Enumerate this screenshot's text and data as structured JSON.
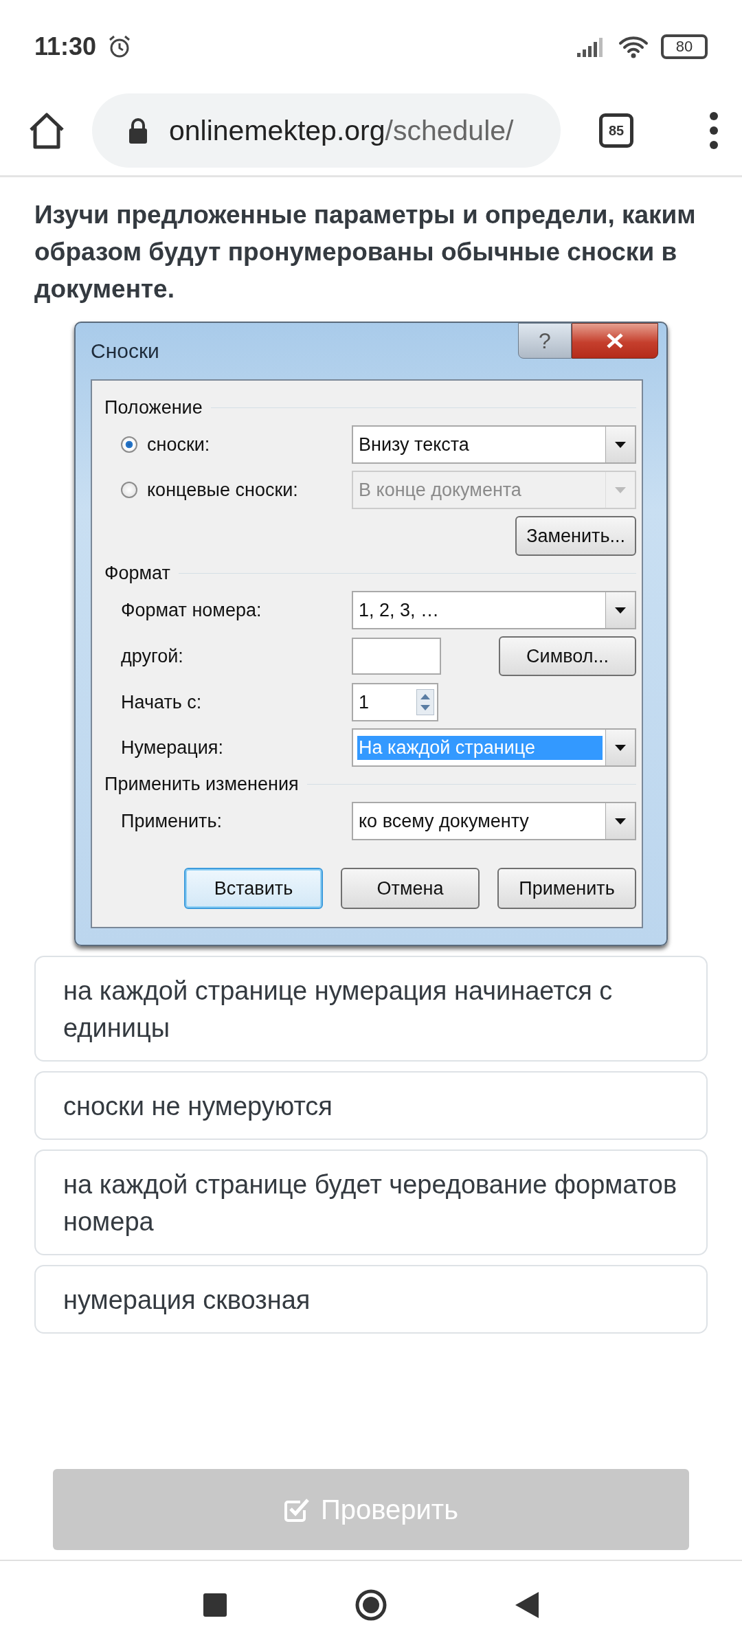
{
  "status_bar": {
    "time": "11:30",
    "battery": "80"
  },
  "browser": {
    "url_host": "onlinemektep.org",
    "url_path": "/schedule/",
    "tabs_count": "85"
  },
  "question": "Изучи предложенные параметры и определи, каким образом будут пронумерованы обычные сноски в документе.",
  "dialog": {
    "title": "Сноски",
    "help_button": "?",
    "sections": [
      {
        "title": "Положение",
        "rows": [
          {
            "kind": "radio",
            "label": "сноски:",
            "selected": true,
            "disabled": false,
            "value": "Внизу текста"
          },
          {
            "kind": "radio",
            "label": "концевые сноски:",
            "selected": false,
            "disabled": true,
            "value": "В конце документа"
          },
          {
            "kind": "button",
            "button": "Заменить..."
          }
        ]
      },
      {
        "title": "Формат",
        "rows": [
          {
            "kind": "dropdown",
            "label": "Формат номера:",
            "value": "1, 2, 3, …",
            "highlighted": false
          },
          {
            "kind": "text",
            "label": "другой:",
            "button": "Символ..."
          },
          {
            "kind": "spinner",
            "label": "Начать с:",
            "value": "1"
          },
          {
            "kind": "dropdown",
            "label": "Нумерация:",
            "value": "На каждой странице",
            "highlighted": true
          }
        ]
      },
      {
        "title": "Применить изменения",
        "rows": [
          {
            "kind": "dropdown",
            "label": "Применить:",
            "value": "ко всему документу",
            "highlighted": false
          }
        ]
      }
    ],
    "buttons": [
      {
        "label": "Вставить",
        "default": true
      },
      {
        "label": "Отмена",
        "default": false
      },
      {
        "label": "Применить",
        "default": false
      }
    ]
  },
  "answers": [
    {
      "text": "на каждой странице нумерация начинается с единицы",
      "selected": false
    },
    {
      "text": "сноски не нумеруются",
      "selected": false
    },
    {
      "text": "на каждой странице будет чередование форматов номера",
      "selected": false
    },
    {
      "text": "нумерация сквозная",
      "selected": false
    }
  ],
  "check_button": {
    "label": "Проверить",
    "disabled": true
  }
}
